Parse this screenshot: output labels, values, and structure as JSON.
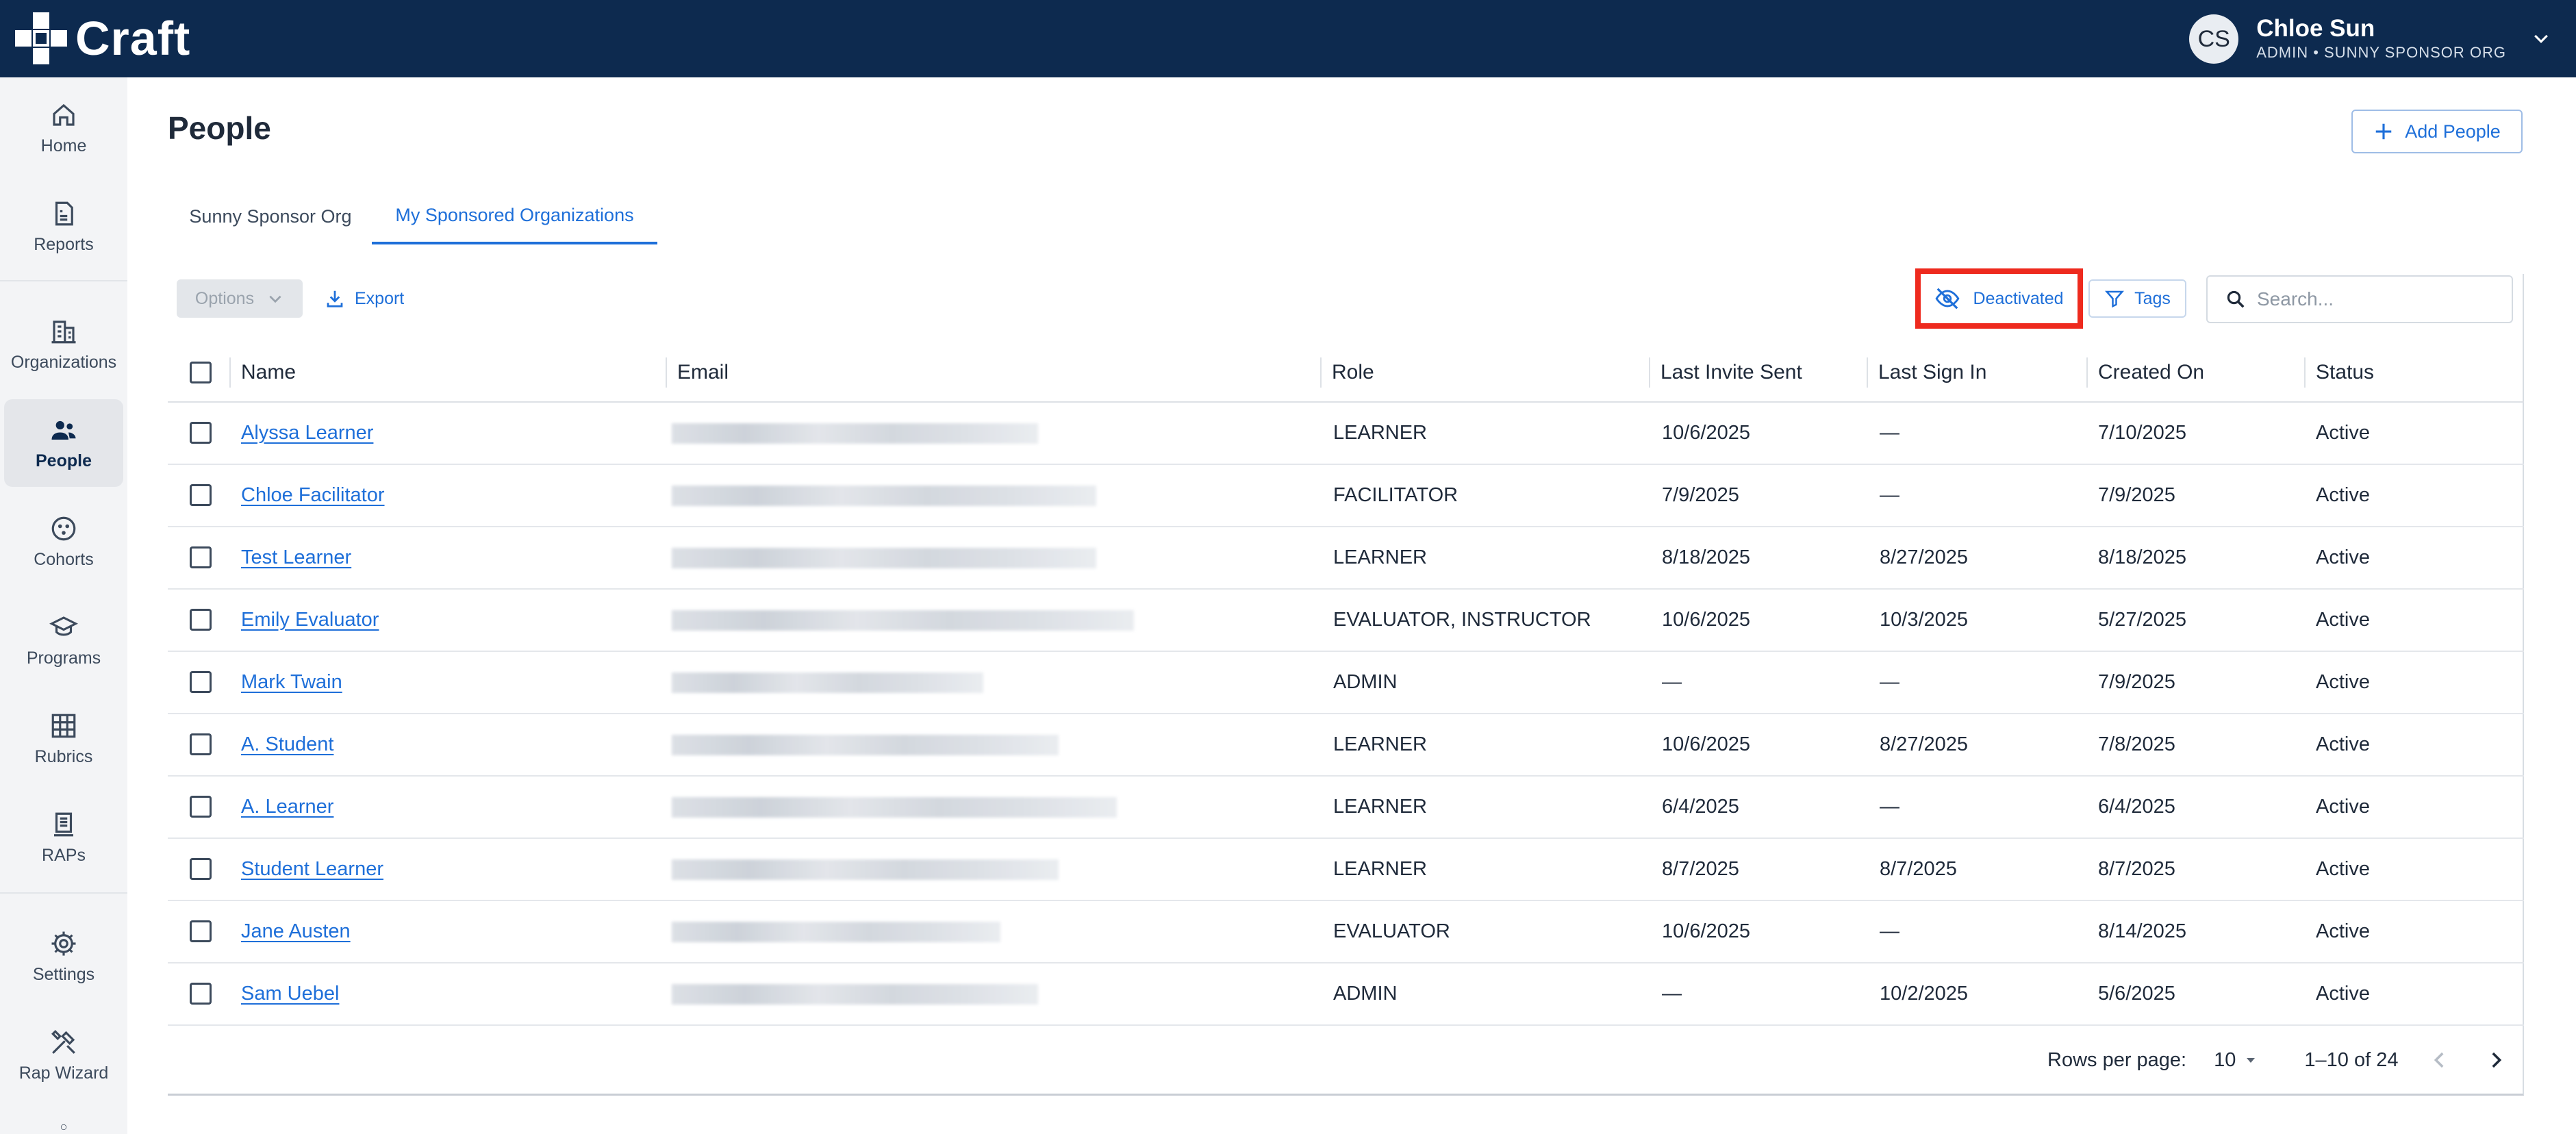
{
  "app": {
    "name": "Craft"
  },
  "user": {
    "initials": "CS",
    "name": "Chloe Sun",
    "role": "ADMIN • SUNNY SPONSOR ORG"
  },
  "sidebar": {
    "items": [
      {
        "label": "Home",
        "icon": "home-icon"
      },
      {
        "label": "Reports",
        "icon": "reports-icon"
      },
      {
        "label": "Organizations",
        "icon": "organizations-icon"
      },
      {
        "label": "People",
        "icon": "people-icon",
        "active": true
      },
      {
        "label": "Cohorts",
        "icon": "cohorts-icon"
      },
      {
        "label": "Programs",
        "icon": "programs-icon"
      },
      {
        "label": "Rubrics",
        "icon": "rubrics-icon"
      },
      {
        "label": "RAPs",
        "icon": "raps-icon"
      },
      {
        "label": "Settings",
        "icon": "settings-icon"
      },
      {
        "label": "Rap Wizard",
        "icon": "rap-wizard-icon"
      }
    ]
  },
  "page": {
    "title": "People",
    "add_label": "Add People"
  },
  "tabs": [
    {
      "label": "Sunny Sponsor Org",
      "active": false
    },
    {
      "label": "My Sponsored Organizations",
      "active": true
    }
  ],
  "toolbar": {
    "options_label": "Options",
    "export_label": "Export",
    "deactivated_label": "Deactivated",
    "tags_label": "Tags",
    "search_placeholder": "Search..."
  },
  "table": {
    "columns": [
      "Name",
      "Email",
      "Role",
      "Last Invite Sent",
      "Last Sign In",
      "Created On",
      "Status"
    ],
    "rows": [
      {
        "name": "Alyssa Learner",
        "role": "LEARNER",
        "invite": "10/6/2025",
        "signin": "—",
        "created": "7/10/2025",
        "status": "Active"
      },
      {
        "name": "Chloe Facilitator",
        "role": "FACILITATOR",
        "invite": "7/9/2025",
        "signin": "—",
        "created": "7/9/2025",
        "status": "Active"
      },
      {
        "name": "Test Learner",
        "role": "LEARNER",
        "invite": "8/18/2025",
        "signin": "8/27/2025",
        "created": "8/18/2025",
        "status": "Active"
      },
      {
        "name": "Emily Evaluator",
        "role": "EVALUATOR, INSTRUCTOR",
        "invite": "10/6/2025",
        "signin": "10/3/2025",
        "created": "5/27/2025",
        "status": "Active"
      },
      {
        "name": "Mark Twain",
        "role": "ADMIN",
        "invite": "—",
        "signin": "—",
        "created": "7/9/2025",
        "status": "Active"
      },
      {
        "name": "A. Student",
        "role": "LEARNER",
        "invite": "10/6/2025",
        "signin": "8/27/2025",
        "created": "7/8/2025",
        "status": "Active"
      },
      {
        "name": "A. Learner",
        "role": "LEARNER",
        "invite": "6/4/2025",
        "signin": "—",
        "created": "6/4/2025",
        "status": "Active"
      },
      {
        "name": "Student Learner",
        "role": "LEARNER",
        "invite": "8/7/2025",
        "signin": "8/7/2025",
        "created": "8/7/2025",
        "status": "Active"
      },
      {
        "name": "Jane Austen",
        "role": "EVALUATOR",
        "invite": "10/6/2025",
        "signin": "—",
        "created": "8/14/2025",
        "status": "Active"
      },
      {
        "name": "Sam Uebel",
        "role": "ADMIN",
        "invite": "—",
        "signin": "10/2/2025",
        "created": "5/6/2025",
        "status": "Active"
      }
    ]
  },
  "pagination": {
    "rows_per_page_label": "Rows per page:",
    "rows_per_page": "10",
    "range": "1–10 of 24"
  },
  "colors": {
    "topbar": "#0d2a4f",
    "accent": "#1e6fd9",
    "highlight": "#ee2a1e"
  }
}
